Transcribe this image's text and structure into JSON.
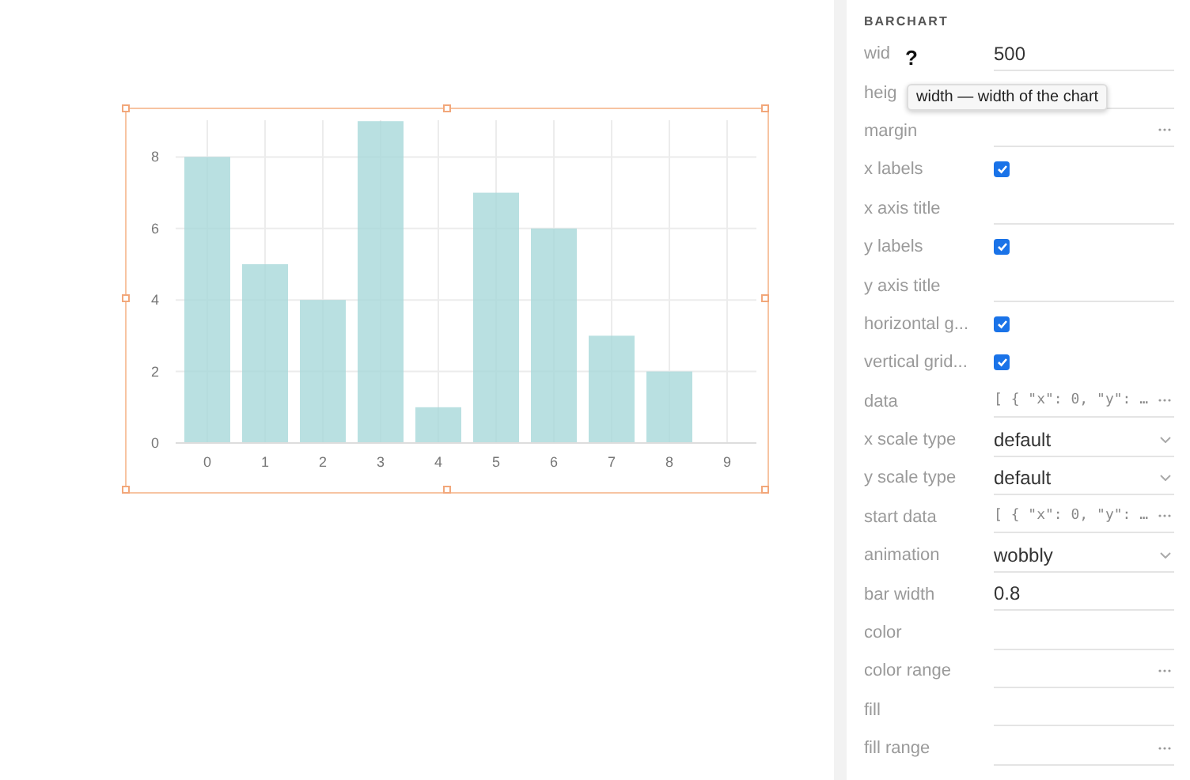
{
  "chart": {
    "chart_data": {
      "type": "bar",
      "categories": [
        "0",
        "1",
        "2",
        "3",
        "4",
        "5",
        "6",
        "7",
        "8",
        "9"
      ],
      "values": [
        8,
        5,
        4,
        9,
        1,
        7,
        6,
        3,
        2,
        null
      ],
      "ylim": [
        0,
        9
      ],
      "grid": true,
      "yticks": [
        0,
        2,
        4,
        6,
        8
      ]
    },
    "selected": true
  },
  "panel": {
    "title": "BARCHART",
    "fields": [
      {
        "label": "wid",
        "kind": "text",
        "value": "500"
      },
      {
        "label": "heig",
        "kind": "text"
      },
      {
        "label": "margin",
        "kind": "more"
      },
      {
        "label": "x labels",
        "kind": "checkbox",
        "checked": true
      },
      {
        "label": "x axis title",
        "kind": "text"
      },
      {
        "label": "y labels",
        "kind": "checkbox",
        "checked": true
      },
      {
        "label": "y axis title",
        "kind": "text"
      },
      {
        "label": "horizontal g...",
        "kind": "checkbox",
        "checked": true
      },
      {
        "label": "vertical grid...",
        "kind": "checkbox",
        "checked": true
      },
      {
        "label": "data",
        "kind": "code",
        "value": "[ { \"x\": 0, \"y\": …"
      },
      {
        "label": "x scale type",
        "kind": "select",
        "value": "default"
      },
      {
        "label": "y scale type",
        "kind": "select",
        "value": "default"
      },
      {
        "label": "start data",
        "kind": "code",
        "value": "[ { \"x\": 0, \"y\": …"
      },
      {
        "label": "animation",
        "kind": "select",
        "value": "wobbly"
      },
      {
        "label": "bar width",
        "kind": "text",
        "value": "0.8"
      },
      {
        "label": "color",
        "kind": "text"
      },
      {
        "label": "color range",
        "kind": "more"
      },
      {
        "label": "fill",
        "kind": "text"
      },
      {
        "label": "fill range",
        "kind": "more"
      }
    ]
  },
  "cursor": "?",
  "tooltip": "width — width of the chart"
}
